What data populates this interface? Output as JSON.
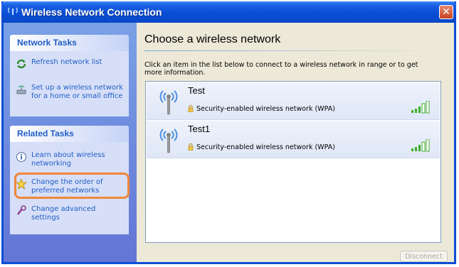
{
  "window": {
    "title": "Wireless Network Connection",
    "close_symbol": "✕"
  },
  "sidebar": {
    "network_tasks": {
      "header": "Network Tasks",
      "items": [
        {
          "label": "Refresh network list",
          "icon": "refresh-icon"
        },
        {
          "label": "Set up a wireless network for a home or small office",
          "icon": "setup-wizard-icon"
        }
      ]
    },
    "related_tasks": {
      "header": "Related Tasks",
      "items": [
        {
          "label": "Learn about wireless networking",
          "icon": "info-icon"
        },
        {
          "label": "Change the order of preferred networks",
          "icon": "star-icon"
        },
        {
          "label": "Change advanced settings",
          "icon": "settings-icon"
        }
      ]
    }
  },
  "main": {
    "title": "Choose a wireless network",
    "instructions": "Click an item in the list below to connect to a wireless network in range or to get more information.",
    "networks": [
      {
        "name": "Test",
        "security": "Security-enabled wireless network (WPA)",
        "signal_bars": 5
      },
      {
        "name": "Test1",
        "security": "Security-enabled wireless network (WPA)",
        "signal_bars": 5
      }
    ],
    "disconnect_label": "Disconnect"
  },
  "colors": {
    "titlebar": "#0a4fd6",
    "link": "#215dc6",
    "highlight": "#f0873a",
    "signal": "#3fae2a"
  }
}
